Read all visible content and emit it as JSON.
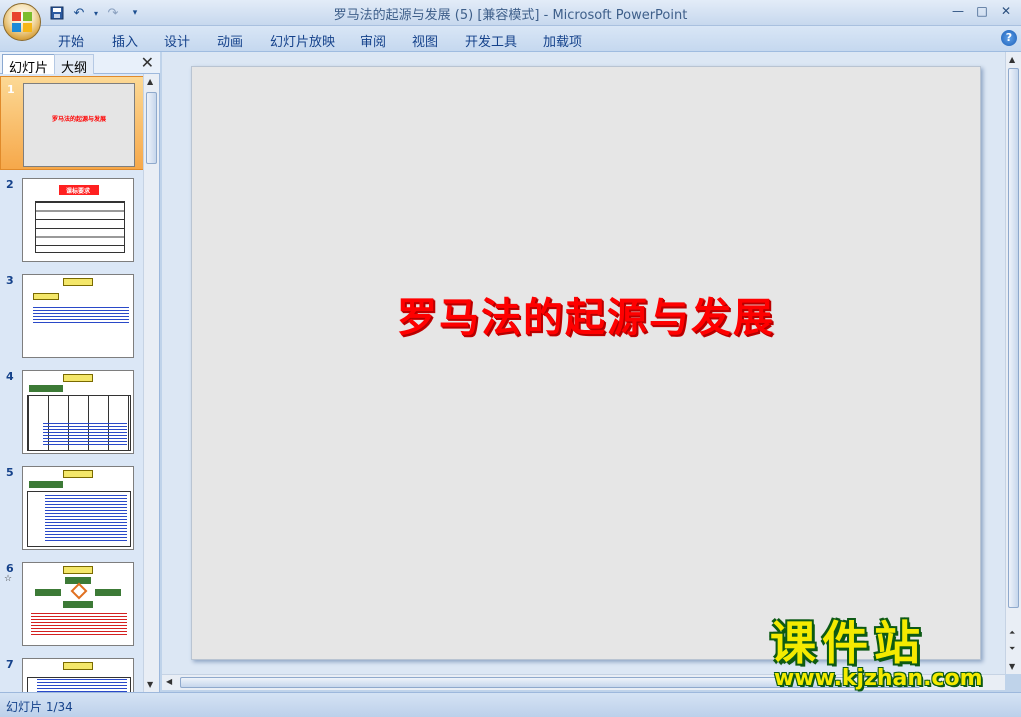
{
  "window": {
    "title": "罗马法的起源与发展 (5) [兼容模式] - Microsoft PowerPoint",
    "controls": [
      "—",
      "□",
      "✕"
    ]
  },
  "quick_access": {
    "save_icon": "save-icon",
    "undo_icon": "undo-icon",
    "redo_icon": "redo-icon",
    "customize_icon": "customize-qat-icon"
  },
  "ribbon": {
    "tabs": [
      "开始",
      "插入",
      "设计",
      "动画",
      "幻灯片放映",
      "审阅",
      "视图",
      "开发工具",
      "加载项"
    ],
    "help": "?"
  },
  "pane": {
    "tab_slides": "幻灯片",
    "tab_outline": "大纲",
    "close": "✕",
    "thumbnails": [
      {
        "num": "1",
        "text": "罗马法的起源与发展"
      },
      {
        "num": "2",
        "text": "课标要求"
      },
      {
        "num": "3",
        "text": ""
      },
      {
        "num": "4",
        "text": ""
      },
      {
        "num": "5",
        "text": ""
      },
      {
        "num": "6",
        "text": ""
      },
      {
        "num": "7",
        "text": ""
      }
    ]
  },
  "slide": {
    "title": "罗马法的起源与发展"
  },
  "status": {
    "slide_counter": "幻灯片 1/34"
  },
  "watermark": {
    "cn": "课件站",
    "url": "www.kjzhan.com"
  },
  "colors": {
    "accent": "#15428b",
    "slide_title": "#ff0000",
    "selection": "#f6a84a"
  }
}
